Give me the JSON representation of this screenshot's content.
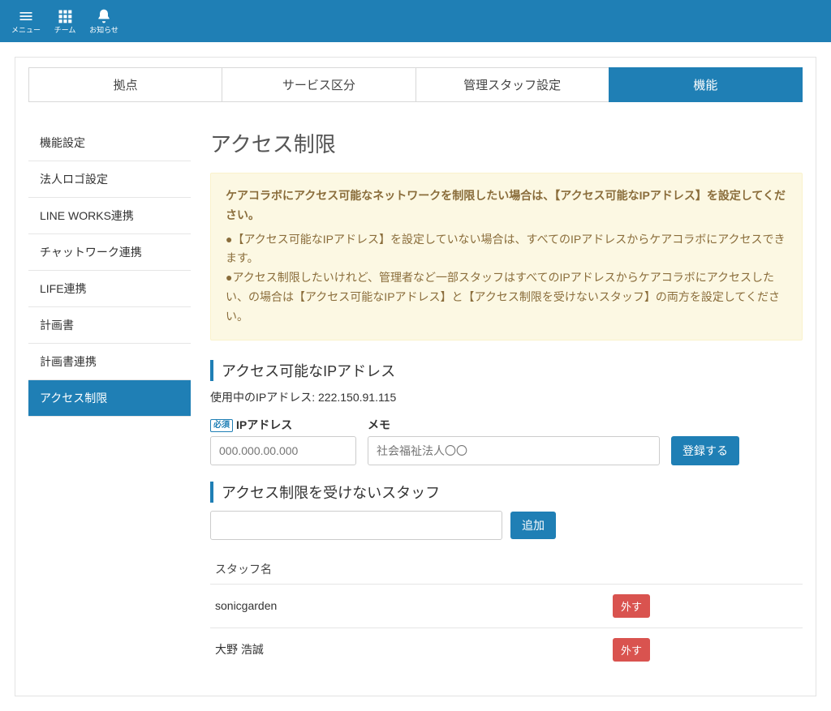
{
  "header": {
    "nav": [
      {
        "icon": "menu",
        "label": "メニュー"
      },
      {
        "icon": "grid",
        "label": "チーム"
      },
      {
        "icon": "bell",
        "label": "お知らせ"
      }
    ]
  },
  "tabs": [
    {
      "label": "拠点",
      "active": false
    },
    {
      "label": "サービス区分",
      "active": false
    },
    {
      "label": "管理スタッフ設定",
      "active": false
    },
    {
      "label": "機能",
      "active": true
    }
  ],
  "sidebar": {
    "items": [
      {
        "label": "機能設定",
        "active": false
      },
      {
        "label": "法人ロゴ設定",
        "active": false
      },
      {
        "label": "LINE WORKS連携",
        "active": false
      },
      {
        "label": "チャットワーク連携",
        "active": false
      },
      {
        "label": "LIFE連携",
        "active": false
      },
      {
        "label": "計画書",
        "active": false
      },
      {
        "label": "計画書連携",
        "active": false
      },
      {
        "label": "アクセス制限",
        "active": true
      }
    ]
  },
  "main": {
    "title": "アクセス制限",
    "alert": {
      "bold": "ケアコラボにアクセス可能なネットワークを制限したい場合は、【アクセス可能なIPアドレス】を設定してください。",
      "line1": "●【アクセス可能なIPアドレス】を設定していない場合は、すべてのIPアドレスからケアコラボにアクセスできます。",
      "line2": "●アクセス制限したいけれど、管理者など一部スタッフはすべてのIPアドレスからケアコラボにアクセスしたい、の場合は【アクセス可能なIPアドレス】と【アクセス制限を受けないスタッフ】の両方を設定してください。"
    },
    "ip_section": {
      "heading": "アクセス可能なIPアドレス",
      "current_ip_label": "使用中のIPアドレス: ",
      "current_ip_value": "222.150.91.115",
      "required_badge": "必須",
      "ip_label": "IPアドレス",
      "ip_placeholder": "000.000.00.000",
      "memo_label": "メモ",
      "memo_placeholder": "社会福祉法人〇〇",
      "submit": "登録する"
    },
    "staff_section": {
      "heading": "アクセス制限を受けないスタッフ",
      "add_button": "追加",
      "col_name": "スタッフ名",
      "remove_label": "外す",
      "rows": [
        {
          "name": "sonicgarden"
        },
        {
          "name": "大野 浩誠"
        }
      ]
    }
  }
}
